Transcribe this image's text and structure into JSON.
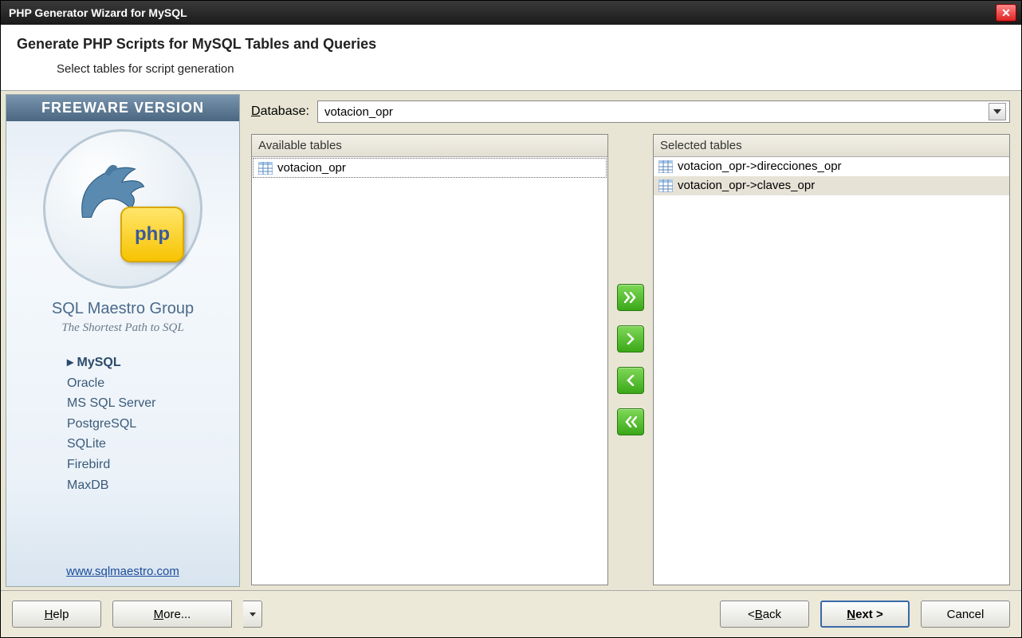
{
  "window": {
    "title": "PHP Generator Wizard for MySQL"
  },
  "header": {
    "title": "Generate PHP Scripts for MySQL Tables and Queries",
    "subtitle": "Select tables for script generation"
  },
  "sidebar": {
    "banner": "FREEWARE VERSION",
    "php_badge": "php",
    "group_name": "SQL Maestro Group",
    "tagline": "The Shortest Path to SQL",
    "databases": [
      "MySQL",
      "Oracle",
      "MS SQL Server",
      "PostgreSQL",
      "SQLite",
      "Firebird",
      "MaxDB"
    ],
    "active_db_index": 0,
    "link": "www.sqlmaestro.com"
  },
  "main": {
    "database_label_prefix": "D",
    "database_label_rest": "atabase:",
    "database_value": "votacion_opr",
    "available_header": "Available tables",
    "available_items": [
      "votacion_opr"
    ],
    "selected_header": "Selected tables",
    "selected_items": [
      "votacion_opr->direcciones_opr",
      "votacion_opr->claves_opr"
    ]
  },
  "footer": {
    "help_u": "H",
    "help_rest": "elp",
    "more_u": "M",
    "more_rest": "ore...",
    "back_pre": "< ",
    "back_u": "B",
    "back_rest": "ack",
    "next_u": "N",
    "next_rest": "ext >",
    "cancel": "Cancel"
  }
}
